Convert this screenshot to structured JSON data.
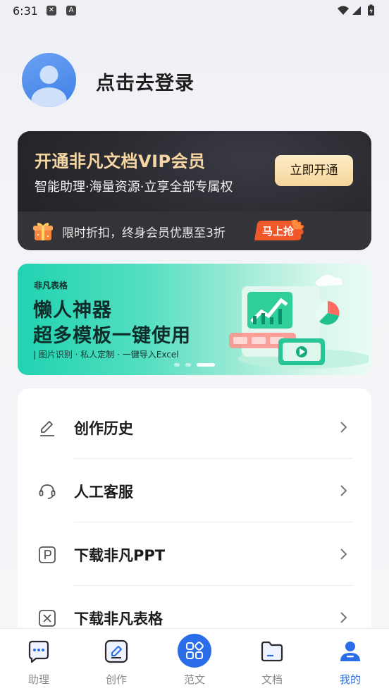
{
  "status_bar": {
    "time": "6:31"
  },
  "profile": {
    "login_text": "点击去登录"
  },
  "vip": {
    "title": "开通非凡文档VIP会员",
    "subtitle": "智能助理·海量资源·立享全部专属权",
    "open_button": "立即开通",
    "promo_text": "限时折扣，终身会员优惠至3折",
    "grab_button": "马上抢"
  },
  "banner": {
    "brand": "非凡表格",
    "line1": "懒人神器",
    "line2": "超多模板一键使用",
    "tagline": "| 图片识别 · 私人定制 · 一键导入Excel",
    "active_dot": 2,
    "dot_count": 3
  },
  "menu": {
    "items": [
      {
        "label": "创作历史",
        "icon": "pencil-icon"
      },
      {
        "label": "人工客服",
        "icon": "headset-icon"
      },
      {
        "label": "下载非凡PPT",
        "icon": "ppt-icon"
      },
      {
        "label": "下载非凡表格",
        "icon": "sheet-icon"
      }
    ]
  },
  "bottom_nav": {
    "items": [
      {
        "label": "助理",
        "icon": "chat-bubble-icon"
      },
      {
        "label": "创作",
        "icon": "edit-icon"
      },
      {
        "label": "范文",
        "icon": "grid-icon"
      },
      {
        "label": "文档",
        "icon": "folder-icon"
      },
      {
        "label": "我的",
        "icon": "user-icon"
      }
    ],
    "active_index": 4
  },
  "colors": {
    "accent": "#2b6de8",
    "vip_gold": "#f6d7a3",
    "banner_green": "#20d3b1"
  }
}
